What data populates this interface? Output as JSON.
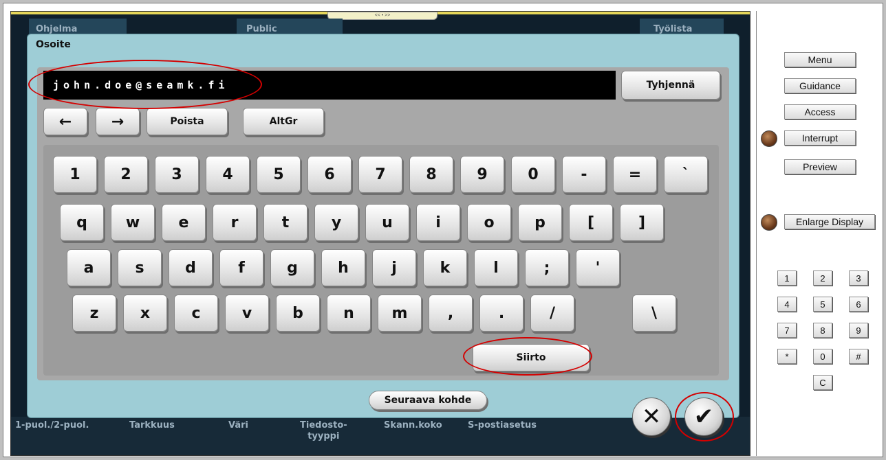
{
  "background_screen": {
    "tabs": [
      "Ohjelma",
      "Public",
      "Työlista"
    ],
    "handle": "<< • >>",
    "bottom_items": [
      "1-puol./2-puol.",
      "Tarkkuus",
      "Väri",
      "Tiedosto-\ntyyppi",
      "Skann.koko",
      "S-postiasetus"
    ]
  },
  "dialog": {
    "title": "Osoite",
    "address_value": "john.doe@seamk.fi",
    "clear_label": "Tyhjennä",
    "nav": {
      "left_arrow": "←",
      "right_arrow": "→",
      "delete_label": "Poista",
      "altgr_label": "AltGr"
    },
    "keys": {
      "row1": [
        "1",
        "2",
        "3",
        "4",
        "5",
        "6",
        "7",
        "8",
        "9",
        "0",
        "-",
        "=",
        "`"
      ],
      "row2": [
        "q",
        "w",
        "e",
        "r",
        "t",
        "y",
        "u",
        "i",
        "o",
        "p",
        "[",
        "]"
      ],
      "row3": [
        "a",
        "s",
        "d",
        "f",
        "g",
        "h",
        "j",
        "k",
        "l",
        ";",
        "'"
      ],
      "row4": [
        "z",
        "x",
        "c",
        "v",
        "b",
        "n",
        "m",
        ",",
        ".",
        "/",
        "\\"
      ]
    },
    "shift_label": "Siirto",
    "next_label": "Seuraava kohde",
    "cancel_symbol": "✕",
    "ok_symbol": "✔"
  },
  "side_panel": {
    "buttons": [
      "Menu",
      "Guidance",
      "Access",
      "Interrupt",
      "Preview",
      "Enlarge Display"
    ],
    "keypad": [
      "1",
      "2",
      "3",
      "4",
      "5",
      "6",
      "7",
      "8",
      "9",
      "*",
      "0",
      "#",
      "C"
    ]
  },
  "colors": {
    "dialog_bg": "#9ecdd6",
    "annotation": "#d40000",
    "screen_bg": "#0f1f2c"
  }
}
